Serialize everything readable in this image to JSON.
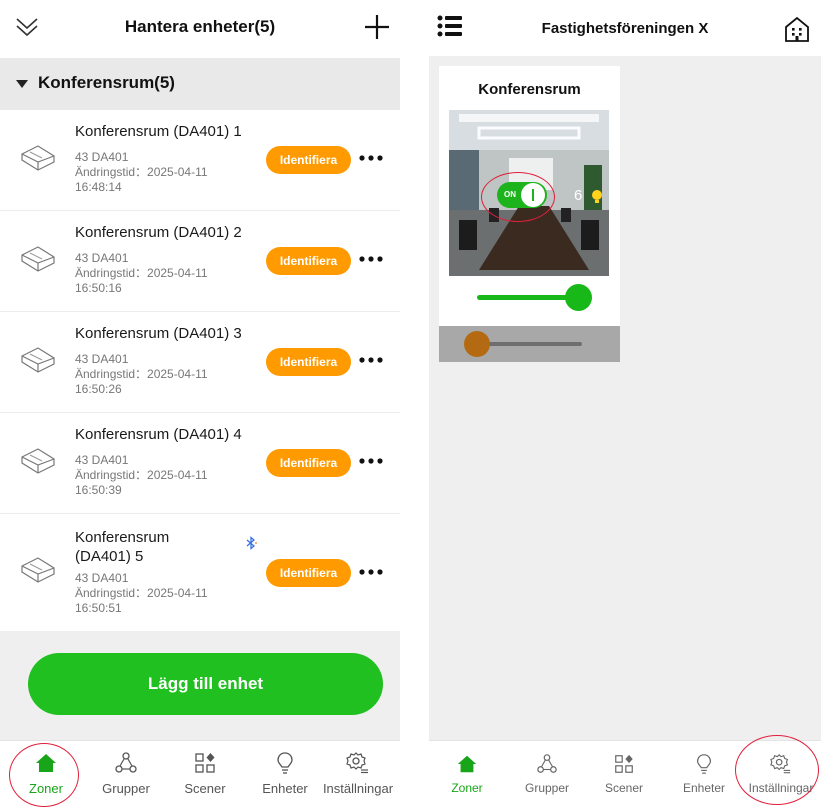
{
  "left": {
    "header": {
      "title": "Hantera enheter(5)",
      "collapse_icon": "double-chevron-down-icon",
      "add_icon": "plus-icon"
    },
    "zone": {
      "label": "Konferensrum(5)"
    },
    "devices": [
      {
        "name": "Konferensrum (DA401) 1",
        "model": "43 DA401",
        "changed_label": "Ändringstid：2025-04-11",
        "changed_time": "16:48:14",
        "identify": "Identifiera"
      },
      {
        "name": "Konferensrum (DA401) 2",
        "model": "43 DA401",
        "changed_label": "Ändringstid：2025-04-11",
        "changed_time": "16:50:16",
        "identify": "Identifiera"
      },
      {
        "name": "Konferensrum (DA401) 3",
        "model": "43 DA401",
        "changed_label": "Ändringstid：2025-04-11",
        "changed_time": "16:50:26",
        "identify": "Identifiera"
      },
      {
        "name": "Konferensrum (DA401) 4",
        "model": "43 DA401",
        "changed_label": "Ändringstid：2025-04-11",
        "changed_time": "16:50:39",
        "identify": "Identifiera"
      },
      {
        "name": "Konferensrum (DA401) 5",
        "model": "43 DA401",
        "changed_label": "Ändringstid：2025-04-11",
        "changed_time": "16:50:51",
        "identify": "Identifiera"
      }
    ],
    "add_button": "Lägg till enhet",
    "tabs": [
      "Zoner",
      "Grupper",
      "Scener",
      "Enheter",
      "Inställningar"
    ]
  },
  "right": {
    "header": {
      "title": "Fastighetsföreningen X",
      "menu_icon": "list-menu-icon",
      "building_icon": "building-icon"
    },
    "zone_card": {
      "title": "Konferensrum",
      "switch_label": "ON",
      "switch_on": true,
      "brightness": "6",
      "dim_level": 1.0,
      "color_temp_level": 0.0
    },
    "tabs": [
      "Zoner",
      "Grupper",
      "Scener",
      "Enheter",
      "Inställningar"
    ]
  },
  "colors": {
    "accent_green": "#20c020",
    "identify_orange": "#ff9a00",
    "highlight_circle": "#e0203a"
  }
}
